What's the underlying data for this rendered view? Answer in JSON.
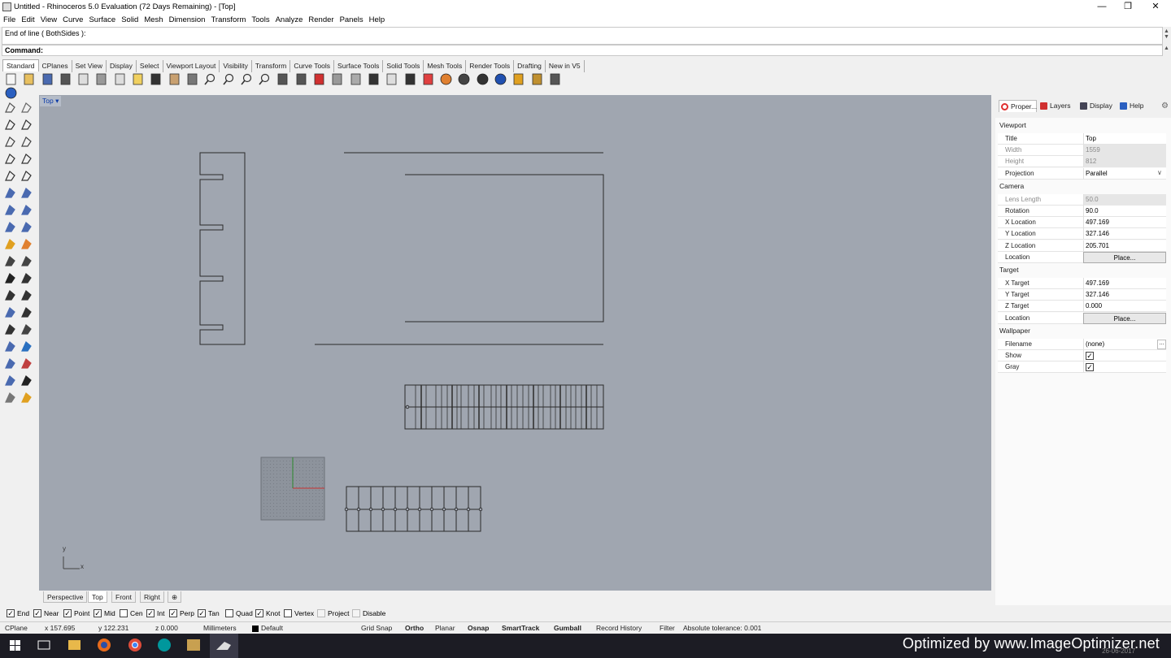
{
  "window": {
    "title": "Untitled - Rhinoceros 5.0 Evaluation (72 Days Remaining) - [Top]",
    "controls": [
      "—",
      "❐",
      "✕"
    ]
  },
  "menu": [
    "File",
    "Edit",
    "View",
    "Curve",
    "Surface",
    "Solid",
    "Mesh",
    "Dimension",
    "Transform",
    "Tools",
    "Analyze",
    "Render",
    "Panels",
    "Help"
  ],
  "command": {
    "history": "End of line ( BothSides ):",
    "prompt": "Command:"
  },
  "toolbar_tabs": [
    "Standard",
    "CPlanes",
    "Set View",
    "Display",
    "Select",
    "Viewport Layout",
    "Visibility",
    "Transform",
    "Curve Tools",
    "Surface Tools",
    "Solid Tools",
    "Mesh Tools",
    "Render Tools",
    "Drafting",
    "New in V5"
  ],
  "toolbar_icons": [
    "new-icon",
    "open-icon",
    "save-icon",
    "print-icon",
    "import-icon",
    "cut-icon",
    "copy-icon",
    "paste-icon",
    "undo-icon",
    "pan-icon",
    "move-view-icon",
    "zoom-icon",
    "zoom-window-icon",
    "zoom-extents-icon",
    "zoom-selected-icon",
    "rotate-view-icon",
    "four-viewports-icon",
    "car-icon",
    "hide-icon",
    "show-icon",
    "lock-icon",
    "light-icon",
    "lock-object-icon",
    "layer-icon",
    "color-wheel-icon",
    "sphere-icon",
    "shaded-sphere-icon",
    "render-icon",
    "draft-icon",
    "gear-icon",
    "options-icon",
    "help-icon"
  ],
  "viewport": {
    "label": "Top",
    "axis_x": "x",
    "axis_y": "y"
  },
  "view_tabs": [
    "Perspective",
    "Top",
    "Front",
    "Right",
    "⊕"
  ],
  "active_view_tab": "Top",
  "osnaps": [
    {
      "label": "End",
      "checked": true
    },
    {
      "label": "Near",
      "checked": true
    },
    {
      "label": "Point",
      "checked": true
    },
    {
      "label": "Mid",
      "checked": true
    },
    {
      "label": "Cen",
      "checked": false
    },
    {
      "label": "Int",
      "checked": true
    },
    {
      "label": "Perp",
      "checked": true
    },
    {
      "label": "Tan",
      "checked": true
    },
    {
      "label": "Quad",
      "checked": false
    },
    {
      "label": "Knot",
      "checked": true
    },
    {
      "label": "Vertex",
      "checked": false
    },
    {
      "label": "Project",
      "checked": false
    },
    {
      "label": "Disable",
      "checked": false
    }
  ],
  "status": {
    "cplane": "CPlane",
    "x": "x 157.695",
    "y": "y 122.231",
    "z": "z 0.000",
    "units": "Millimeters",
    "layer": "Default",
    "grid_snap": "Grid Snap",
    "ortho": "Ortho",
    "planar": "Planar",
    "osnap": "Osnap",
    "smarttrack": "SmartTrack",
    "gumball": "Gumball",
    "record_history": "Record History",
    "filter": "Filter",
    "tolerance": "Absolute tolerance: 0.001"
  },
  "panel": {
    "tabs": [
      "Proper...",
      "Layers",
      "Display",
      "Help"
    ],
    "viewport_section": "Viewport",
    "viewport_rows": [
      {
        "key": "Title",
        "value": "Top",
        "disabled": false
      },
      {
        "key": "Width",
        "value": "1559",
        "disabled": true
      },
      {
        "key": "Height",
        "value": "812",
        "disabled": true
      },
      {
        "key": "Projection",
        "value": "Parallel",
        "disabled": false
      }
    ],
    "camera_section": "Camera",
    "camera_rows": [
      {
        "key": "Lens Length",
        "value": "50.0",
        "disabled": true
      },
      {
        "key": "Rotation",
        "value": "90.0",
        "disabled": false
      },
      {
        "key": "X Location",
        "value": "497.169",
        "disabled": false
      },
      {
        "key": "Y Location",
        "value": "327.146",
        "disabled": false
      },
      {
        "key": "Z Location",
        "value": "205.701",
        "disabled": false
      },
      {
        "key": "Location",
        "value": "Place...",
        "disabled": false,
        "button": true
      }
    ],
    "target_section": "Target",
    "target_rows": [
      {
        "key": "X Target",
        "value": "497.169",
        "disabled": false
      },
      {
        "key": "Y Target",
        "value": "327.146",
        "disabled": false
      },
      {
        "key": "Z Target",
        "value": "0.000",
        "disabled": false
      },
      {
        "key": "Location",
        "value": "Place...",
        "disabled": false,
        "button": true
      }
    ],
    "wallpaper_section": "Wallpaper",
    "wallpaper_rows": [
      {
        "key": "Filename",
        "value": "(none)"
      },
      {
        "key": "Show",
        "checked": true
      },
      {
        "key": "Gray",
        "checked": true
      }
    ]
  },
  "watermark": "Optimized by www.ImageOptimizer.net",
  "taskbar_date": "26-06-2017",
  "colors": {
    "viewport_bg": "#a0a6b0",
    "panel_bg": "#f0f0f0",
    "taskbar": "#1c1c24",
    "active_view": "#0a3aa8"
  }
}
